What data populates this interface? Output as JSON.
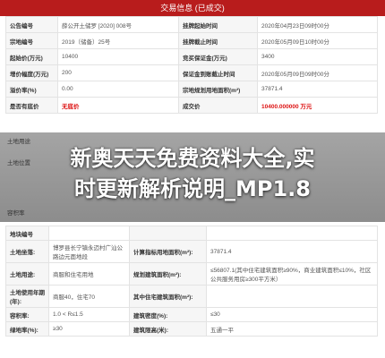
{
  "header": {
    "title": "交易信息 (已成交)"
  },
  "info_rows": [
    {
      "l1": "公告编号",
      "v1": "薛公开土储罗 [2020] 008号",
      "l2": "挂牌起始时间",
      "v2": "2020年04月23日09时00分"
    },
    {
      "l1": "宗地编号",
      "v1": "2019（储备）25号",
      "l2": "挂牌截止时间",
      "v2": "2020年05月09日10时00分"
    },
    {
      "l1": "起始价(万元)",
      "v1": "10400",
      "l2": "竞买保证金(万元)",
      "v2": "3400"
    },
    {
      "l1": "增价幅度(万元)",
      "v1": "200",
      "l2": "保证金到账截止时间",
      "v2": "2020年05月09日09时00分"
    },
    {
      "l1": "溢价率(%)",
      "v1": "0.00",
      "l2": "宗地规划用地面积(m²)",
      "v2": "37871.4"
    },
    {
      "l1": "是否有底价",
      "v1": "无底价",
      "l2": "成交价",
      "v2": "10400.000000 万元"
    }
  ],
  "side_labels": [
    "土地用途",
    "土地位置",
    "容积率"
  ],
  "banner": {
    "line1": "新奥天天免费资料大全,实",
    "line2": "时更新解析说明_MP1.8"
  },
  "detail_rows": [
    {
      "l1": "地块编号",
      "v1": "",
      "l2": "",
      "v2": ""
    },
    {
      "l1": "土地坐落:",
      "v1": "博罗县长宁镇永迈村广汕公路边元面地段",
      "l2": "计算指标用地面积(m²):",
      "v2": "37871.4"
    },
    {
      "l1": "土地用途:",
      "v1": "商服和住宅用地",
      "l2": "规划建筑面积(m²):",
      "v2": "≤56807.1(其中住宅建筑面积≥90%，商业建筑面积≤10%，社区公共服务用房≥300平方米）"
    },
    {
      "l1": "土地使用年期(年):",
      "v1": "商服40，住宅70",
      "l2": "其中住宅建筑面积(m²):",
      "v2": ""
    },
    {
      "l1": "容积率:",
      "v1": "1.0 < R≤1.5",
      "l2": "建筑密度(%):",
      "v2": "≤30"
    },
    {
      "l1": "绿地率(%):",
      "v1": "≥30",
      "l2": "建筑限高(米):",
      "v2": "五通一平"
    }
  ]
}
